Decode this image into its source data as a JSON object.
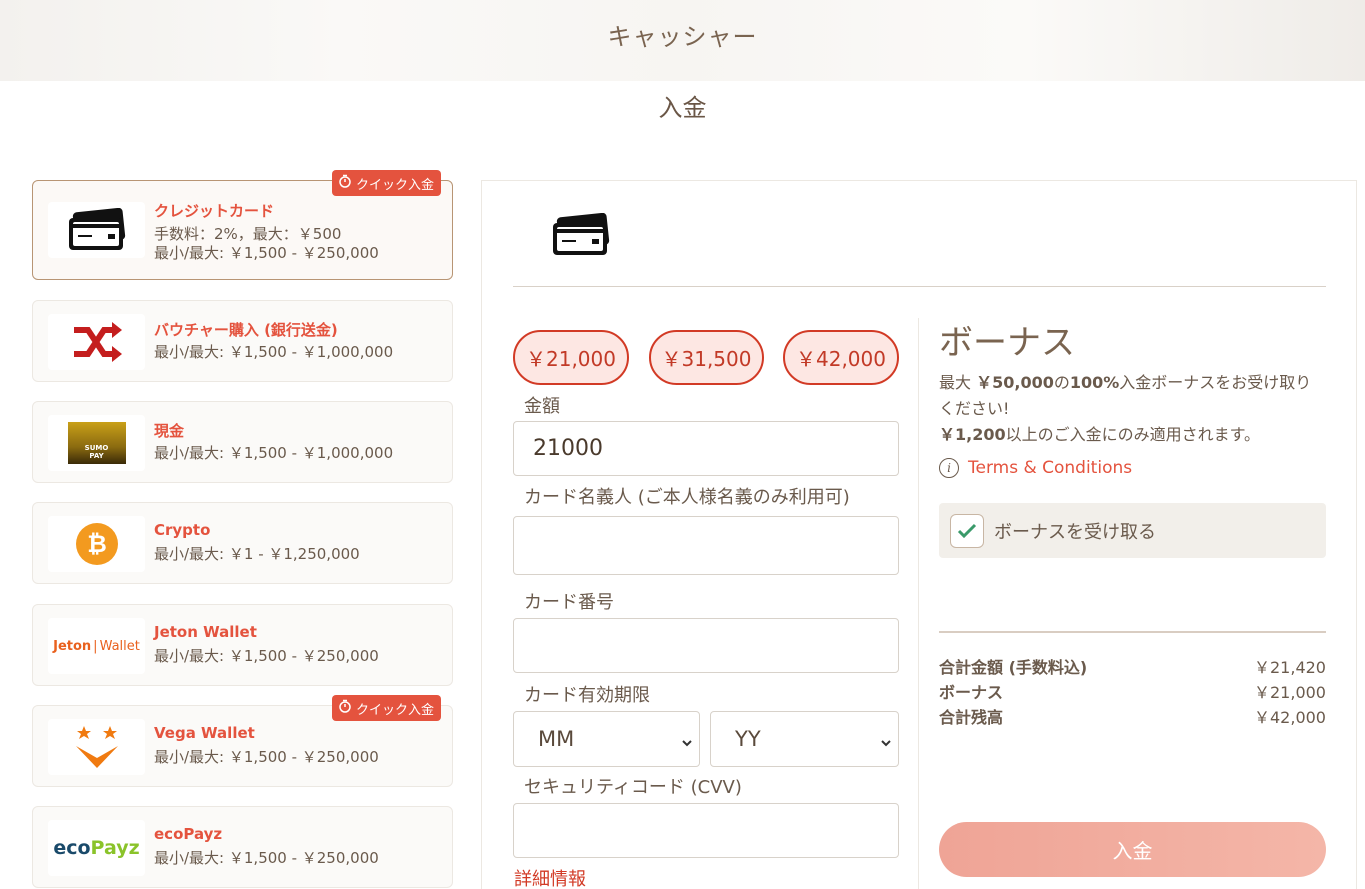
{
  "header": {
    "title": "キャッシャー",
    "subtitle": "入金"
  },
  "methods": [
    {
      "name": "クレジットカード",
      "line1": "手数料：2%，最大：￥500",
      "line2": "最小/最大: ￥1,500 - ￥250,000",
      "badge": "クイック入金",
      "icon": "credit-card-icon",
      "active": true
    },
    {
      "name": "バウチャー購入 (銀行送金)",
      "line1": "最小/最大: ￥1,500 - ￥1,000,000",
      "icon": "shuffle-icon"
    },
    {
      "name": "現金",
      "line1": "最小/最大: ￥1,500 - ￥1,000,000",
      "icon": "sumo-pay-logo",
      "logo_text": "SUMO PAY"
    },
    {
      "name": "Crypto",
      "line1": "最小/最大: ￥1 - ￥1,250,000",
      "icon": "bitcoin-icon"
    },
    {
      "name": "Jeton Wallet",
      "line1": "最小/最大: ￥1,500 - ￥250,000",
      "icon": "jeton-logo",
      "logo_text_a": "Jeton",
      "logo_text_b": "Wallet"
    },
    {
      "name": "Vega Wallet",
      "line1": "最小/最大: ￥1,500 - ￥250,000",
      "badge": "クイック入金",
      "icon": "vega-logo"
    },
    {
      "name": "ecoPayz",
      "line1": "最小/最大: ￥1,500 - ￥250,000",
      "icon": "ecopayz-logo",
      "logo_text_a": "eco",
      "logo_text_b": "Payz"
    }
  ],
  "form": {
    "presets": [
      "￥21,000",
      "￥31,500",
      "￥42,000"
    ],
    "amount_label": "金額",
    "amount_value": "21000",
    "holder_label": "カード名義人 (ご本人様名義のみ利用可)",
    "number_label": "カード番号",
    "expiry_label": "カード有効期限",
    "month_value": "MM",
    "year_value": "YY",
    "cvv_label": "セキュリティコード (CVV)",
    "more_info": "詳細情報"
  },
  "bonus": {
    "title": "ボーナス",
    "desc_pre": "最大 ",
    "desc_amount": "￥50,000",
    "desc_mid": "の",
    "desc_pct": "100%",
    "desc_post": "入金ボーナスをお受け取りください!",
    "min_amount": "￥1,200",
    "min_text": "以上のご入金にのみ適用されます。",
    "terms": "Terms & Conditions",
    "toggle_label": "ボーナスを受け取る",
    "toggle_checked": true
  },
  "summary": [
    {
      "label": "合計金額 (手数料込)",
      "value": "￥21,420"
    },
    {
      "label": "ボーナス",
      "value": "￥21,000"
    },
    {
      "label": "合計残高",
      "value": "￥42,000"
    }
  ],
  "deposit_button": "入金",
  "colors": {
    "accent": "#e4533e",
    "brown": "#7a6450",
    "preset_bg": "#fde7e3",
    "button": "#f2ad9f"
  }
}
